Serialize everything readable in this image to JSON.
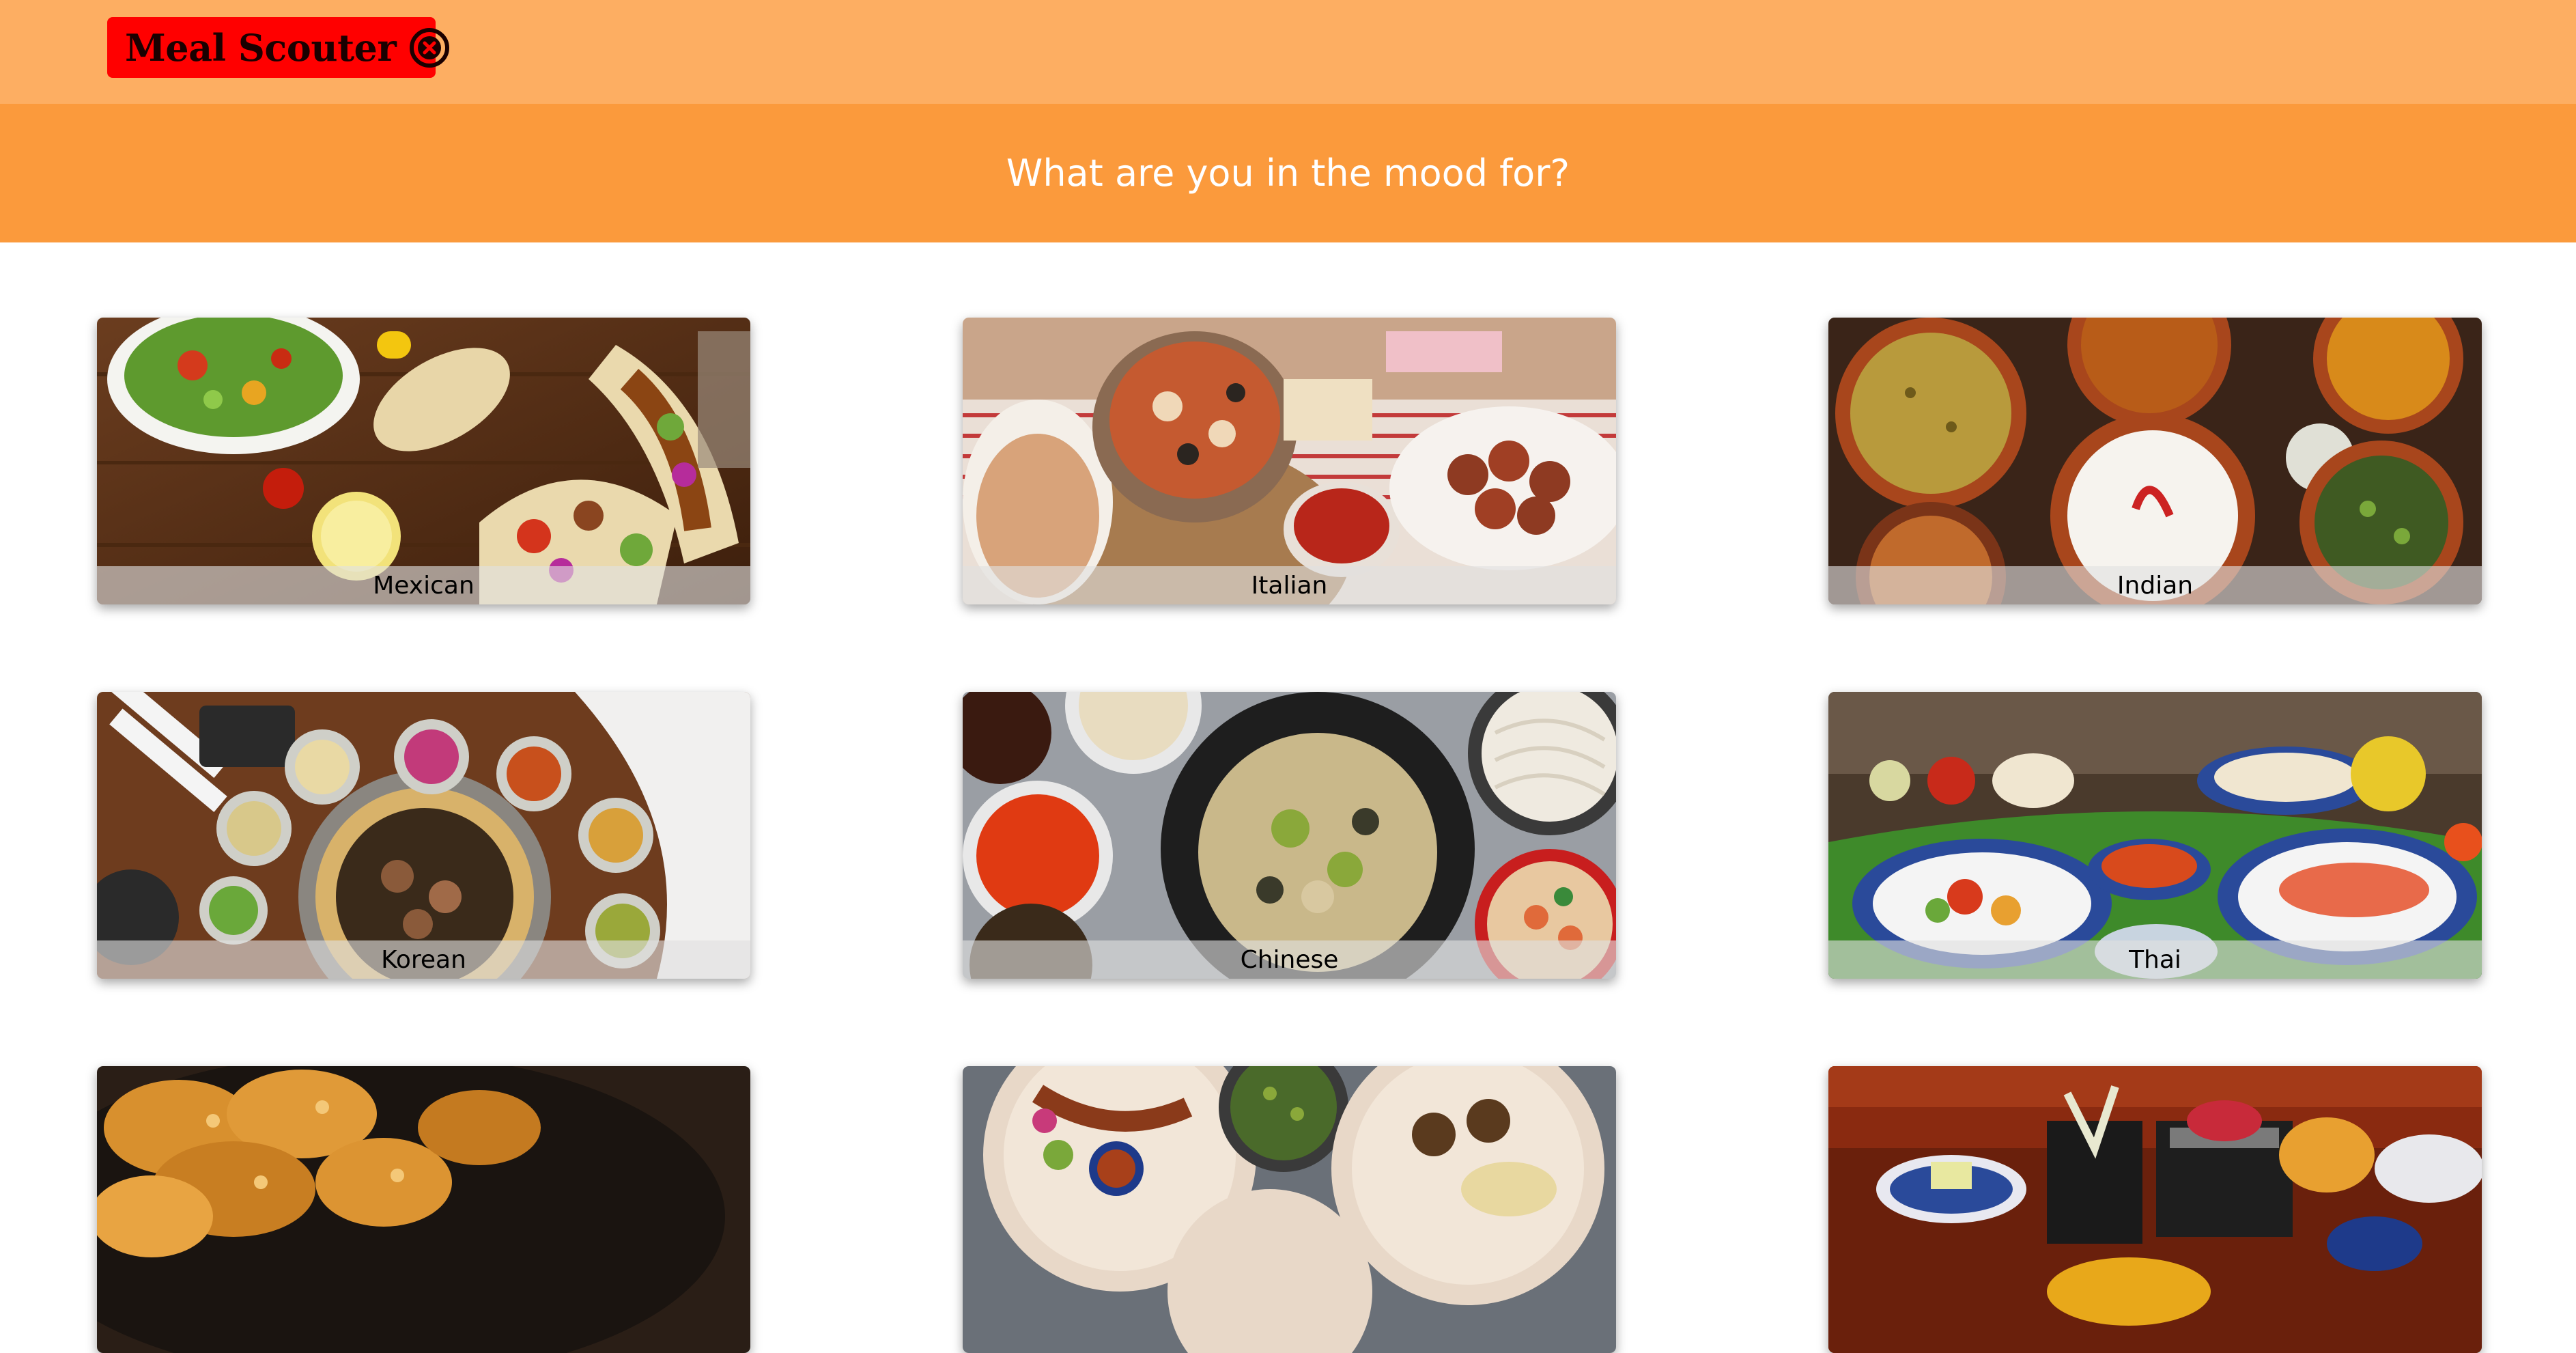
{
  "header": {
    "logo_text": "Meal Scouter",
    "logo_icon": "close-circle-icon",
    "logo_bg_color": "#FF0000",
    "bar_color": "#FDAE62"
  },
  "hero": {
    "title": "What are you in the mood for?",
    "bg_color": "#FB9A3C"
  },
  "cuisines": [
    {
      "label": "Mexican",
      "icon": "mexican-food-image"
    },
    {
      "label": "Italian",
      "icon": "italian-food-image"
    },
    {
      "label": "Indian",
      "icon": "indian-food-image"
    },
    {
      "label": "Korean",
      "icon": "korean-food-image"
    },
    {
      "label": "Chinese",
      "icon": "chinese-food-image"
    },
    {
      "label": "Thai",
      "icon": "thai-food-image"
    },
    {
      "label": "",
      "icon": "fried-chicken-food-image"
    },
    {
      "label": "",
      "icon": "middle-eastern-food-image"
    },
    {
      "label": "",
      "icon": "japanese-food-image"
    }
  ]
}
